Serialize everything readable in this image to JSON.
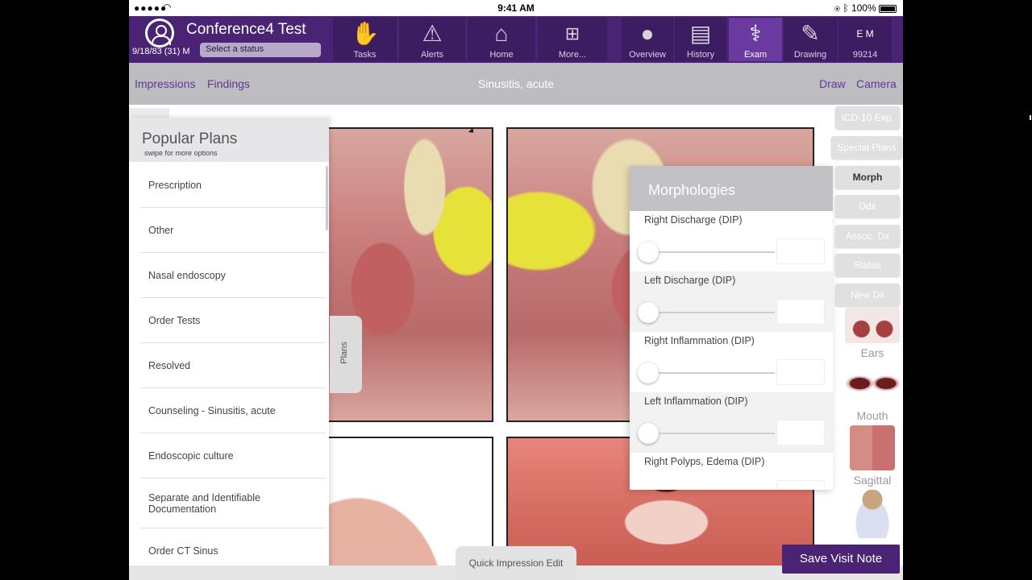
{
  "status_bar": {
    "signal": "●●●●● ",
    "time": "9:41 AM",
    "battery": "100%"
  },
  "header": {
    "patient_name": "Conference4  Test",
    "patient_info": "9/18/83 (31) M",
    "status_placeholder": "Select a status",
    "nav": [
      {
        "label": "Tasks",
        "icon": "hand-icon"
      },
      {
        "label": "Alerts",
        "icon": "warning-icon"
      },
      {
        "label": "Home",
        "icon": "home-icon"
      },
      {
        "label": "More...",
        "icon": "org-chart-icon"
      },
      {
        "label": "Overview",
        "icon": "head-icon"
      },
      {
        "label": "History",
        "icon": "clipboard-icon"
      },
      {
        "label": "Exam",
        "icon": "stethoscope-icon"
      },
      {
        "label": "Drawing",
        "icon": "palette-icon"
      },
      {
        "label": "99214",
        "icon": "em-caduceus-icon",
        "badge": "E  M"
      }
    ]
  },
  "subheader": {
    "impressions": "Impressions",
    "findings": "Findings",
    "title": "Sinusitis, acute",
    "draw": "Draw",
    "camera": "Camera"
  },
  "plans": {
    "title": "Popular Plans",
    "subtitle": "swipe for more options",
    "items": [
      "Prescription",
      "Other",
      "Nasal endoscopy",
      "Order Tests",
      "Resolved",
      "Counseling - Sinusitis, acute",
      "Endoscopic culture",
      "Separate and Identifiable Documentation",
      "Order CT Sinus"
    ],
    "tab_label": "Plans"
  },
  "morphologies": {
    "title": "Morphologies",
    "rows": [
      {
        "label": "Right Discharge (DIP)",
        "value": ""
      },
      {
        "label": "Left Discharge (DIP)",
        "value": ""
      },
      {
        "label": "Right Inflammation (DIP)",
        "value": ""
      },
      {
        "label": "Left Inflammation (DIP)",
        "value": ""
      },
      {
        "label": "Right Polyps, Edema (DIP)",
        "value": ""
      }
    ]
  },
  "side_buttons": [
    "ICD-10 Exp.",
    "Special Plans",
    "Morph",
    "Ddx",
    "Assoc. Dx",
    "Status",
    "New Dx"
  ],
  "thumbnails": [
    "Ears",
    "Mouth",
    "Sagittal"
  ],
  "bottom": {
    "quick_edit": "Quick Impression Edit",
    "save": "Save Visit Note"
  },
  "colors": {
    "header_purple": "#4a2374",
    "active_tab": "#6b3aa0",
    "link_purple": "#5b3b92"
  }
}
